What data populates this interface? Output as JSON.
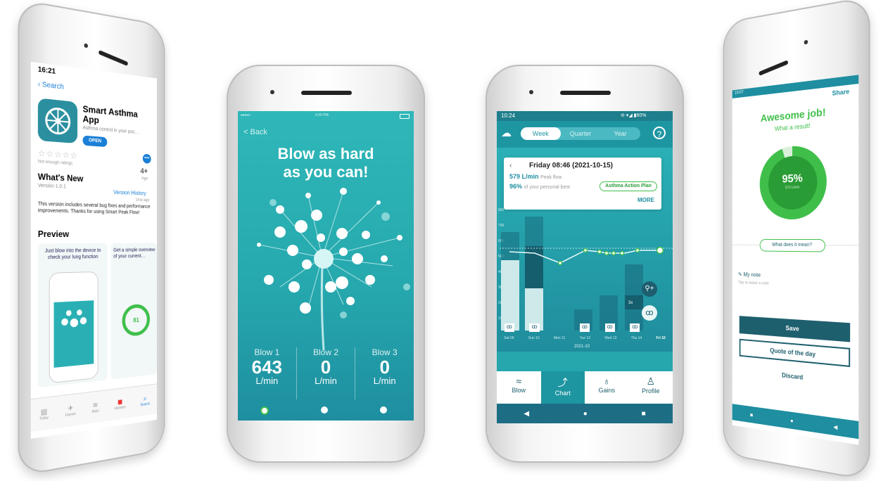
{
  "p1": {
    "time": "16:21",
    "back": "Search",
    "app_title": "Smart Asthma App",
    "app_subtitle": "Asthma control in your poc…",
    "open_label": "OPEN",
    "age": "4+",
    "age_sub": "Age",
    "ratings": "Not enough ratings",
    "whats_new": "What's New",
    "version_history": "Version History",
    "version": "Version 1.0.1",
    "ago": "1mo ago",
    "notes": "This version includes several bug fixes and performance improvements. Thanks for using Smart Peak Flow!",
    "preview": "Preview",
    "shot1_caption": "Just blow into the device to check your lung function",
    "shot2_caption": "Get a simple overview of your current…",
    "shot2_pct": "81",
    "tabs": [
      "Today",
      "Games",
      "Apps",
      "Updates",
      "Search"
    ]
  },
  "p2": {
    "carrier": "●●●●○",
    "time": "4:20 PM",
    "back": "< Back",
    "headline1": "Blow as hard",
    "headline2": "as you can!",
    "blows": [
      {
        "label": "Blow 1",
        "value": "643",
        "unit": "L/min"
      },
      {
        "label": "Blow 2",
        "value": "0",
        "unit": "L/min"
      },
      {
        "label": "Blow 3",
        "value": "0",
        "unit": "L/min"
      }
    ]
  },
  "p3": {
    "time": "10:24",
    "status_right": "⊖ ▾◢ ▮60%",
    "segments": [
      "Week",
      "Quarter",
      "Year"
    ],
    "help": "?",
    "card_date": "Friday 08:46 (2021-10-15)",
    "card_flow_value": "579 L/min",
    "card_flow_label": "Peak flow",
    "card_pct_value": "96%",
    "card_pct_label": "of your personal best",
    "card_plan": "Asthma Action Plan",
    "card_more": "MORE",
    "y_ticks": [
      "800",
      "700",
      "600",
      "500",
      "400",
      "300",
      "200",
      "100"
    ],
    "x_days": [
      "Sat 09",
      "Sun 10",
      "Mon 11",
      "Tue 12",
      "Wed 13",
      "Thu 14",
      "Fri 15"
    ],
    "month": "2021-10",
    "bar_count_labels": [
      "3x",
      "3x",
      "3x"
    ],
    "nav": [
      "Blow",
      "Chart",
      "Gains",
      "Profile"
    ]
  },
  "p4": {
    "time": "10:07",
    "share": "Share",
    "title": "Awesome job!",
    "subtitle": "What a result!",
    "pct": "95%",
    "pct_sub": "573 L/min",
    "what": "What does it mean?",
    "note_label": "My note",
    "note_placeholder": "Tap to leave a note",
    "save": "Save",
    "quote": "Quote of the day",
    "discard": "Discard"
  },
  "colors": {
    "teal": "#2ab0b4",
    "dark_teal": "#1d6e84",
    "green": "#3fbf4a",
    "blue": "#1a7fd6"
  }
}
